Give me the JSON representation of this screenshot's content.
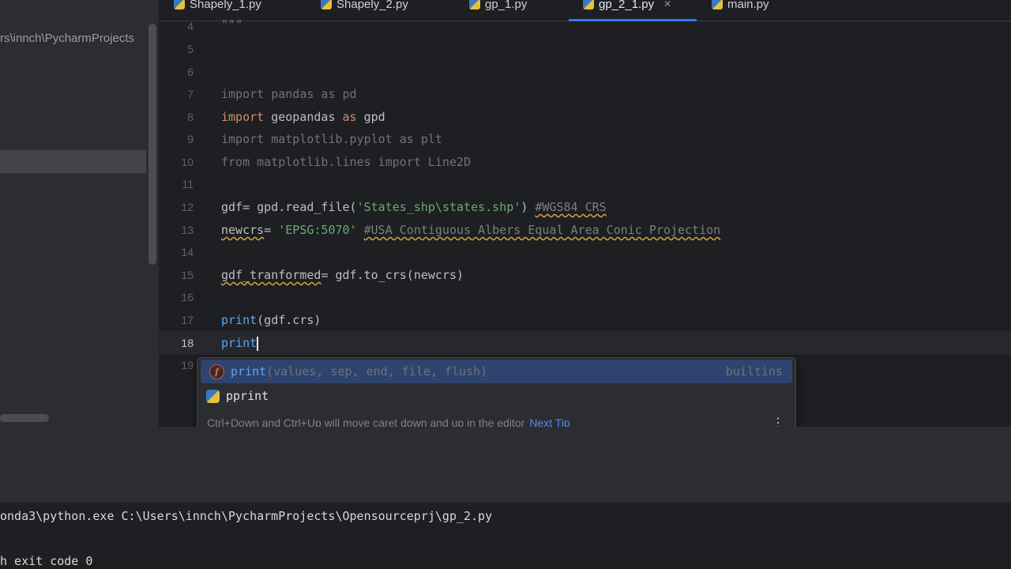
{
  "sidebar": {
    "path_text": "rs\\innch\\PycharmProjects"
  },
  "tabs": [
    {
      "label": "Shapely_1.py",
      "active": false
    },
    {
      "label": "Shapely_2.py",
      "active": false
    },
    {
      "label": "gp_1.py",
      "active": false
    },
    {
      "label": "gp_2_1.py",
      "active": true
    },
    {
      "label": "main.py",
      "active": false
    }
  ],
  "editor": {
    "line_numbers": [
      "4",
      "5",
      "6",
      "7",
      "8",
      "9",
      "10",
      "11",
      "12",
      "13",
      "14",
      "15",
      "16",
      "17",
      "18",
      "19"
    ],
    "code": {
      "l4": "\"\"\"",
      "l7_kw": "import",
      "l7_rest": " pandas as pd",
      "l8_kw": "import",
      "l8_mod": " geopandas ",
      "l8_as": "as",
      "l8_alias": " gpd",
      "l9": "import matplotlib.pyplot as plt",
      "l10": "from matplotlib.lines import Line2D",
      "l12_a": "gdf= gpd.read_file(",
      "l12_str": "'States_shp\\states.shp'",
      "l12_b": ") ",
      "l12_cmt": "#WGS84 CRS",
      "l13_var": "newcrs",
      "l13_eq": "= ",
      "l13_str": "'EPSG:5070'",
      "l13_sp": " ",
      "l13_cmt": "#USA Contiguous Albers Equal Area Conic Projection",
      "l15_var": "gdf_tranformed",
      "l15_rest": "= gdf.to_crs(newcrs)",
      "l17_fn": "print",
      "l17_rest": "(gdf.crs)",
      "l18_fn": "print"
    }
  },
  "completion": {
    "items": [
      {
        "icon": "f",
        "name": "print",
        "signature": "(values, sep, end, file, flush)",
        "source": "builtins"
      },
      {
        "icon": "python-icon",
        "name": "pprint",
        "signature": "",
        "source": ""
      }
    ],
    "tip": "Ctrl+Down and Ctrl+Up will move caret down and up in the editor",
    "tip_link": "Next Tip"
  },
  "terminal": {
    "line1": "onda3\\python.exe C:\\Users\\innch\\PycharmProjects\\Opensourceprj\\gp_2.py",
    "line2": "h exit code 0"
  }
}
